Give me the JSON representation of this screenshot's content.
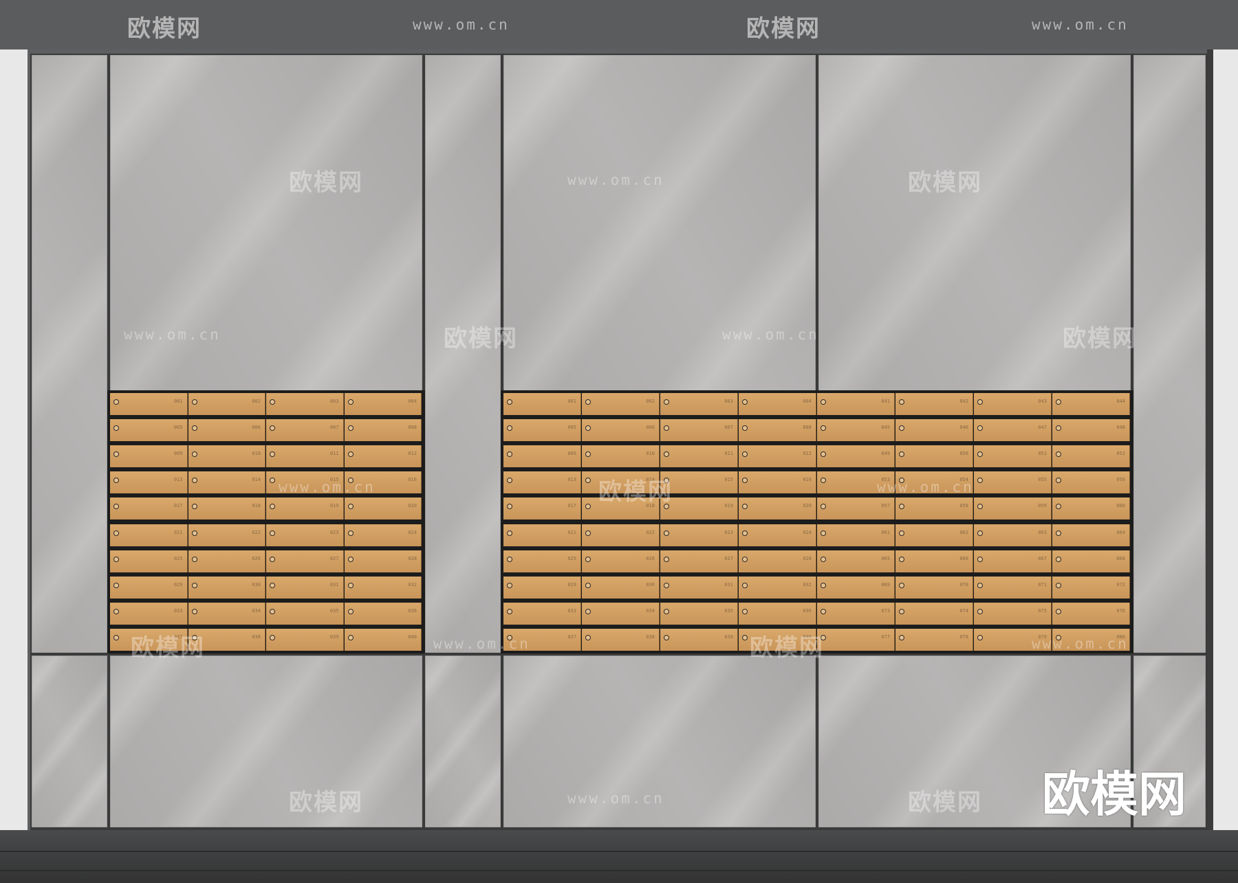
{
  "scene": {
    "colors": {
      "marble": "#b2b0af",
      "mailbox_door": "#d0a064",
      "frame": "#1c1c1c",
      "floor": "#3e3f40"
    }
  },
  "watermarks": {
    "logo_text": "欧模网",
    "url_text": "www.om.cn",
    "corner_logo": "欧模网"
  },
  "mailboxes": {
    "left_bank": {
      "numbers": [
        [
          "001",
          "002",
          "003",
          "004"
        ],
        [
          "005",
          "006",
          "007",
          "008"
        ],
        [
          "009",
          "010",
          "011",
          "012"
        ],
        [
          "013",
          "014",
          "015",
          "016"
        ],
        [
          "017",
          "018",
          "019",
          "020"
        ],
        [
          "021",
          "022",
          "023",
          "024"
        ],
        [
          "025",
          "026",
          "027",
          "028"
        ],
        [
          "029",
          "030",
          "031",
          "032"
        ],
        [
          "033",
          "034",
          "035",
          "036"
        ],
        [
          "037",
          "038",
          "039",
          "040"
        ]
      ]
    },
    "right_bank": {
      "numbers": [
        [
          "001",
          "002",
          "003",
          "004",
          "041",
          "042",
          "043",
          "044"
        ],
        [
          "005",
          "006",
          "007",
          "008",
          "045",
          "046",
          "047",
          "048"
        ],
        [
          "009",
          "010",
          "011",
          "012",
          "049",
          "050",
          "051",
          "052"
        ],
        [
          "013",
          "014",
          "015",
          "016",
          "053",
          "054",
          "055",
          "056"
        ],
        [
          "017",
          "018",
          "019",
          "020",
          "057",
          "058",
          "059",
          "060"
        ],
        [
          "021",
          "022",
          "023",
          "024",
          "061",
          "062",
          "063",
          "064"
        ],
        [
          "025",
          "026",
          "027",
          "028",
          "065",
          "066",
          "067",
          "068"
        ],
        [
          "029",
          "030",
          "031",
          "032",
          "069",
          "070",
          "071",
          "072"
        ],
        [
          "033",
          "034",
          "035",
          "036",
          "073",
          "074",
          "075",
          "076"
        ],
        [
          "037",
          "038",
          "039",
          "040",
          "077",
          "078",
          "079",
          "080"
        ]
      ]
    }
  }
}
